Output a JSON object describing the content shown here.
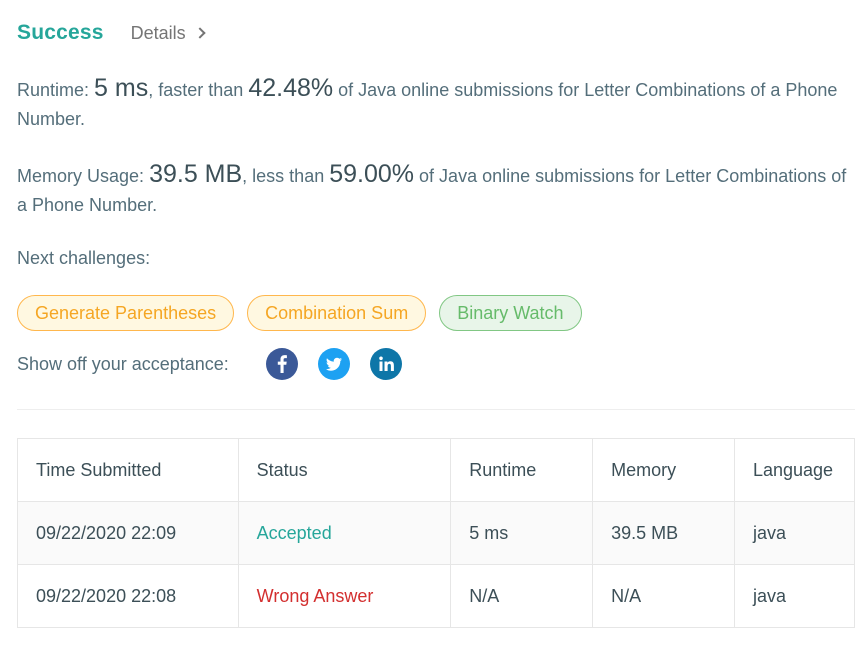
{
  "header": {
    "status": "Success",
    "details_label": "Details"
  },
  "runtime": {
    "label": "Runtime:",
    "value": "5 ms",
    "mid": ", faster than",
    "percent": "42.48%",
    "suffix": "of Java online submissions for Letter Combinations of a Phone Number."
  },
  "memory": {
    "label": "Memory Usage:",
    "value": "39.5 MB",
    "mid": ", less than",
    "percent": "59.00%",
    "suffix": "of Java online submissions for Letter Combinations of a Phone Number."
  },
  "next_challenges": {
    "label": "Next challenges:",
    "items": [
      "Generate Parentheses",
      "Combination Sum",
      "Binary Watch"
    ]
  },
  "share": {
    "label": "Show off your acceptance:"
  },
  "icons": {
    "facebook": "facebook-icon",
    "twitter": "twitter-icon",
    "linkedin": "linkedin-icon"
  },
  "colors": {
    "accent": "#26a69a",
    "error": "#d32f2f",
    "facebook": "#3b5998",
    "twitter": "#1da1f2",
    "linkedin": "#0e76a8"
  },
  "table": {
    "headers": [
      "Time Submitted",
      "Status",
      "Runtime",
      "Memory",
      "Language"
    ],
    "rows": [
      [
        "09/22/2020 22:09",
        "Accepted",
        "5 ms",
        "39.5 MB",
        "java"
      ],
      [
        "09/22/2020 22:08",
        "Wrong Answer",
        "N/A",
        "N/A",
        "java"
      ]
    ]
  }
}
